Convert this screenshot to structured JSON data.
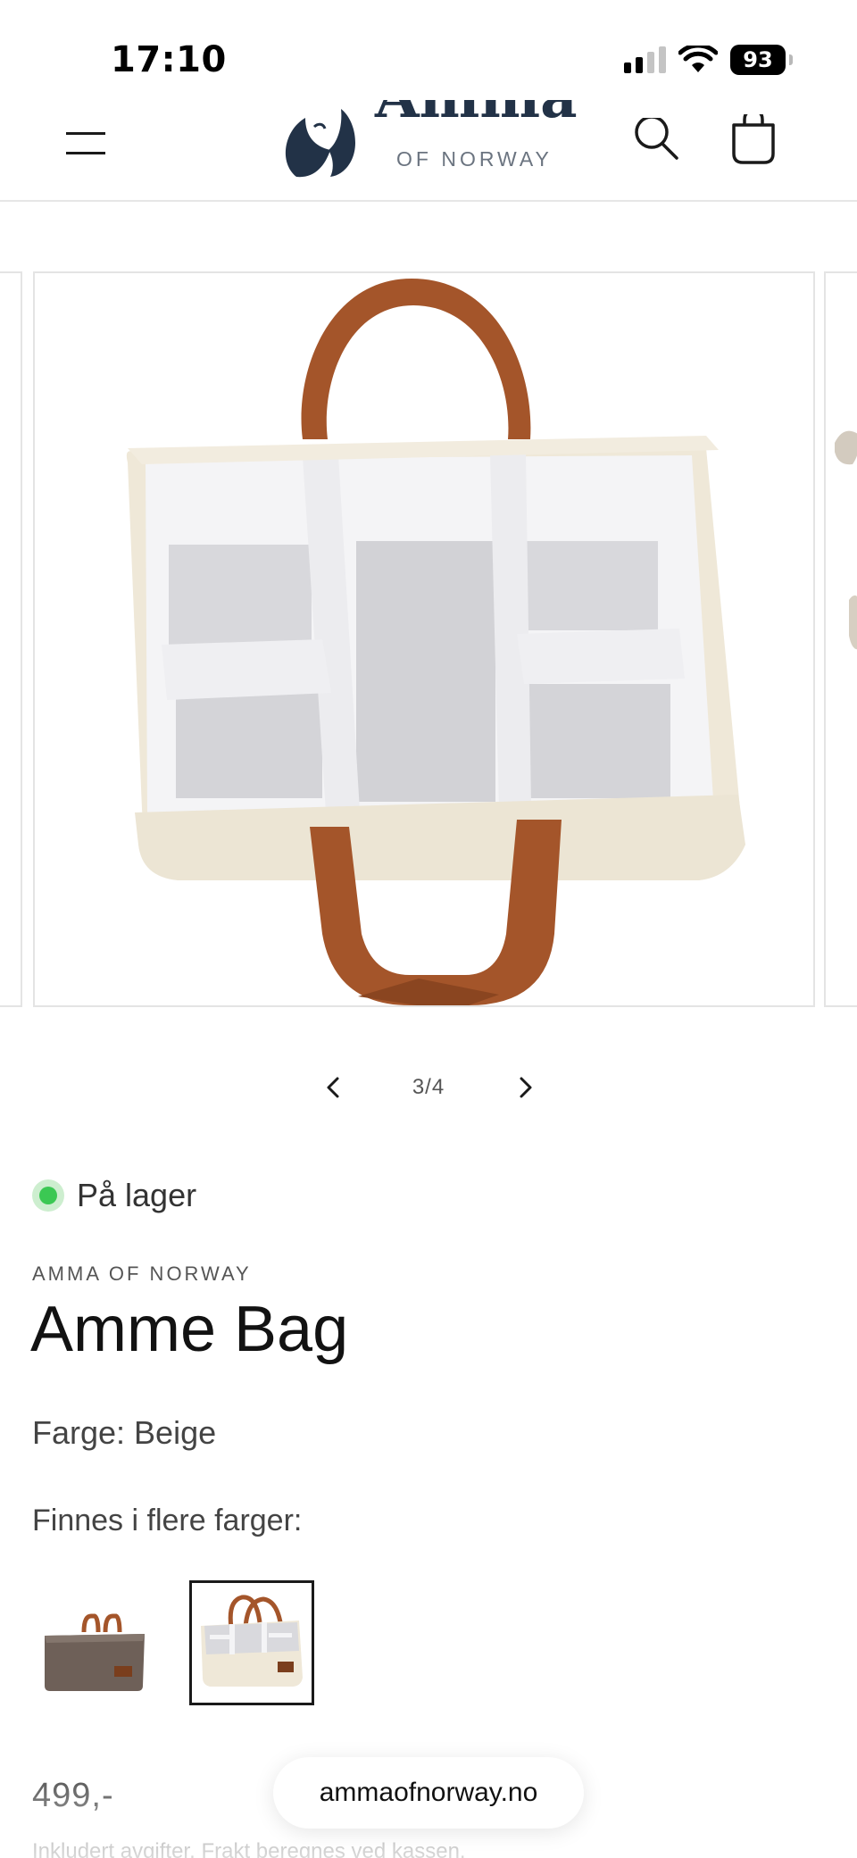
{
  "status_bar": {
    "time": "17:10",
    "battery": "93"
  },
  "header": {
    "logo_word": "Amma",
    "logo_subtitle": "OF NORWAY",
    "menu_icon": "hamburger-menu-icon",
    "search_icon": "search-icon",
    "cart_icon": "shopping-bag-icon"
  },
  "gallery": {
    "counter": "3/4"
  },
  "product": {
    "stock_status": "På lager",
    "stock_color": "#3bc853",
    "vendor": "AMMA OF NORWAY",
    "title": "Amme Bag",
    "color_label": "Farge: Beige",
    "more_colors_label": "Finnes i flere farger:",
    "price": "499,-",
    "tax_note_prefix": "Inkludert avgifter. ",
    "tax_note_link": "Frakt",
    "tax_note_suffix": " beregnes ved kassen."
  },
  "browser": {
    "url": "ammaofnorway.no"
  },
  "colors": {
    "brand": "#223247",
    "leather": "#a4552a",
    "felt": "#efe8d8"
  }
}
